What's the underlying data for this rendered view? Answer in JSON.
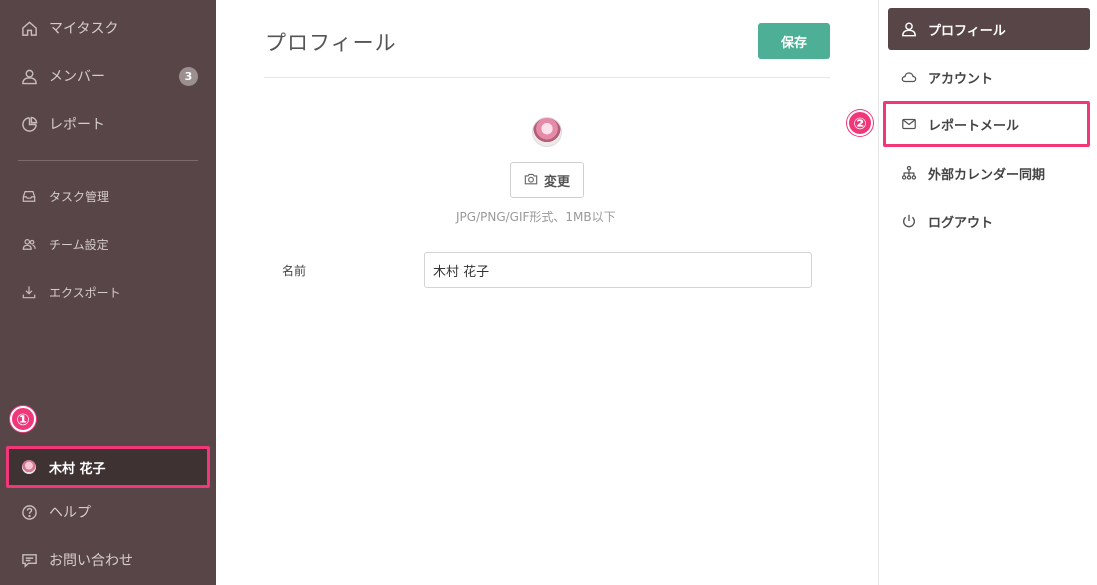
{
  "sidebar": {
    "items": [
      {
        "label": "マイタスク",
        "icon": "home-icon"
      },
      {
        "label": "メンバー",
        "icon": "user-icon",
        "badge": "3"
      },
      {
        "label": "レポート",
        "icon": "pie-chart-icon"
      },
      {
        "label": "タスク管理",
        "icon": "inbox-icon"
      },
      {
        "label": "チーム設定",
        "icon": "team-icon"
      },
      {
        "label": "エクスポート",
        "icon": "download-icon"
      }
    ],
    "user": {
      "name": "木村 花子"
    },
    "footer": [
      {
        "label": "ヘルプ",
        "icon": "help-icon"
      },
      {
        "label": "お問い合わせ",
        "icon": "chat-icon"
      }
    ]
  },
  "markers": {
    "one": "①",
    "two": "②"
  },
  "main": {
    "title": "プロフィール",
    "save_label": "保存",
    "change_label": "変更",
    "hint": "JPG/PNG/GIF形式、1MB以下",
    "name_label": "名前",
    "name_value": "木村 花子"
  },
  "right_menu": {
    "items": [
      {
        "label": "プロフィール",
        "icon": "user-icon",
        "active": true
      },
      {
        "label": "アカウント",
        "icon": "cloud-icon"
      },
      {
        "label": "レポートメール",
        "icon": "mail-icon",
        "highlighted": true
      },
      {
        "label": "外部カレンダー同期",
        "icon": "sitemap-icon"
      },
      {
        "label": "ログアウト",
        "icon": "power-icon"
      }
    ]
  },
  "colors": {
    "sidebar_bg": "#574547",
    "accent_green": "#4daf96",
    "highlight_pink": "#f0377a"
  }
}
